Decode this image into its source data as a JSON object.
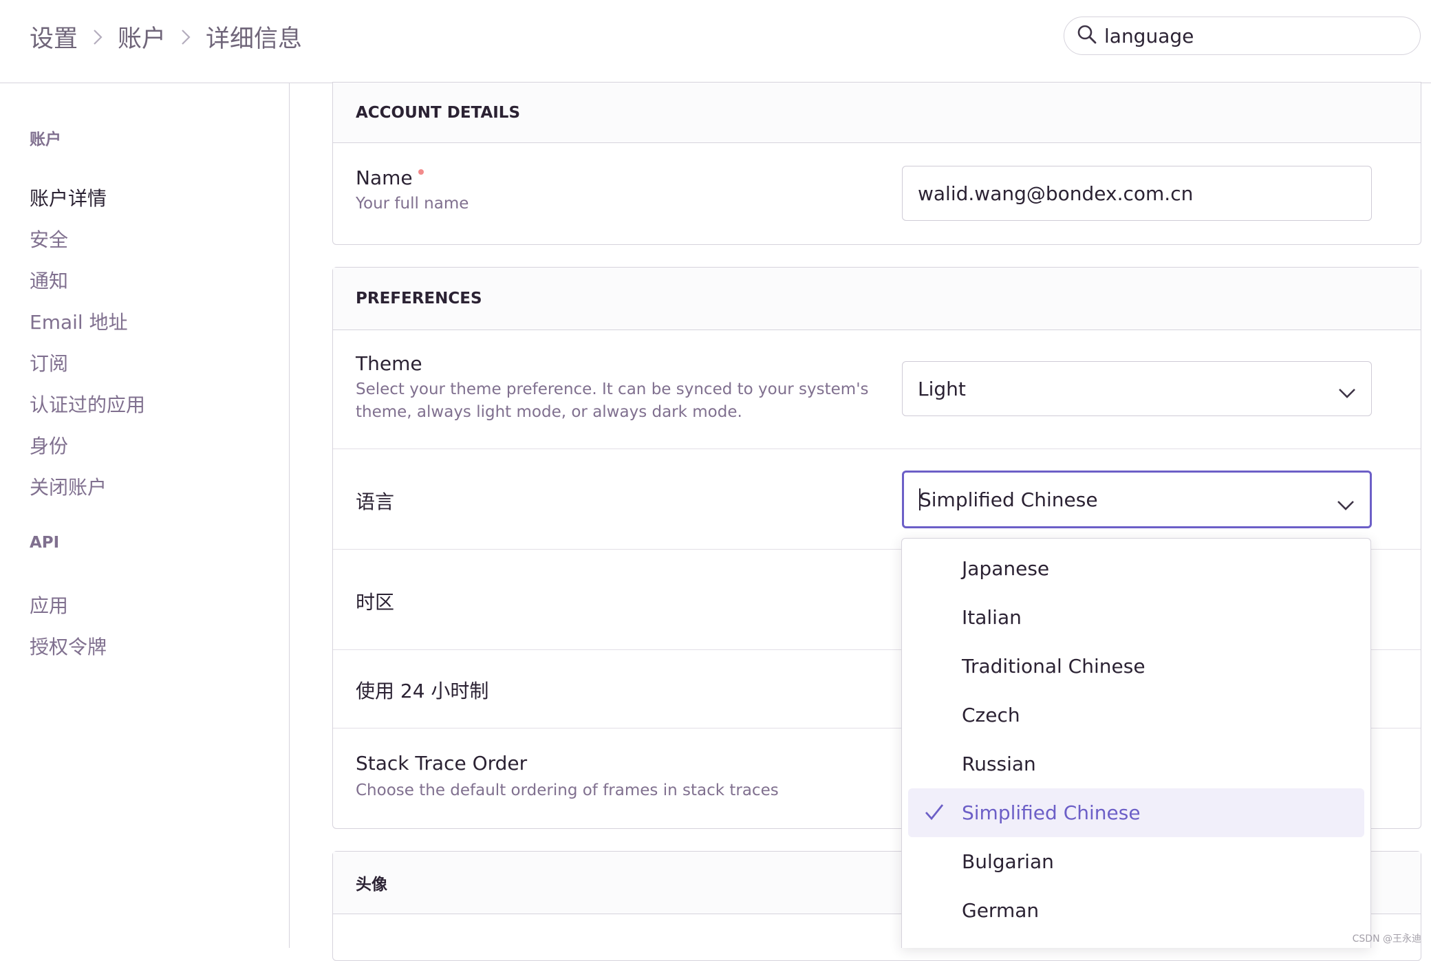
{
  "header": {
    "breadcrumbs": [
      "设置",
      "账户",
      "详细信息"
    ],
    "search_value": "language"
  },
  "sidebar": {
    "group_account": "账户",
    "account_items": [
      "账户详情",
      "安全",
      "通知",
      "Email 地址",
      "订阅",
      "认证过的应用",
      "身份",
      "关闭账户"
    ],
    "active_item": "账户详情",
    "group_api": "API",
    "api_items": [
      "应用",
      "授权令牌"
    ]
  },
  "account_details": {
    "title": "ACCOUNT DETAILS",
    "name_label": "Name",
    "name_help": "Your full name",
    "name_value": "walid.wang@bondex.com.cn"
  },
  "preferences": {
    "title": "PREFERENCES",
    "theme_label": "Theme",
    "theme_help": "Select your theme preference. It can be synced to your system's theme, always light mode, or always dark mode.",
    "theme_value": "Light",
    "language_label": "语言",
    "language_value": "Simplified Chinese",
    "timezone_label": "时区",
    "clock24_label": "使用 24 小时制",
    "stacktrace_label": "Stack Trace Order",
    "stacktrace_help": "Choose the default ordering of frames in stack traces"
  },
  "avatar": {
    "title": "头像"
  },
  "language_dropdown": {
    "options": [
      "Japanese",
      "Italian",
      "Traditional Chinese",
      "Czech",
      "Russian",
      "Simplified Chinese",
      "Bulgarian",
      "German"
    ],
    "selected": "Simplified Chinese"
  },
  "colors": {
    "accent": "#6c5fc7",
    "text": "#2b2233",
    "muted": "#80708f",
    "border": "#d6d3dc"
  },
  "watermark": "CSDN @王永迪"
}
